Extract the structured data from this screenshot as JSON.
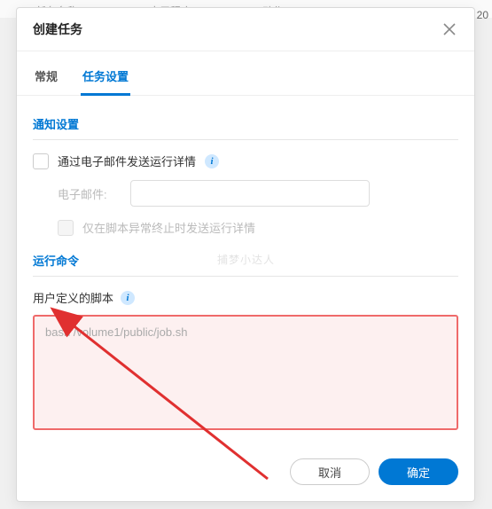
{
  "backdrop": {
    "col1": "任务名称",
    "col2": "应用程序",
    "col3": "动作",
    "right_fragment": "20"
  },
  "modal": {
    "title": "创建任务",
    "tabs": {
      "general": "常规",
      "settings": "任务设置"
    },
    "sections": {
      "notification": {
        "title": "通知设置",
        "email_checkbox_label": "通过电子邮件发送运行详情",
        "email_field_label": "电子邮件:",
        "email_value": "",
        "only_on_error_label": "仅在脚本异常终止时发送运行详情"
      },
      "run_command": {
        "title": "运行命令",
        "script_label": "用户定义的脚本",
        "script_value": "bash /volume1/public/job.sh"
      }
    },
    "footer": {
      "cancel": "取消",
      "ok": "确定"
    }
  },
  "watermark": "捕梦小达人",
  "colors": {
    "accent": "#0078d4",
    "highlight_border": "#ef6a6a",
    "highlight_bg": "#fdf0f0"
  }
}
